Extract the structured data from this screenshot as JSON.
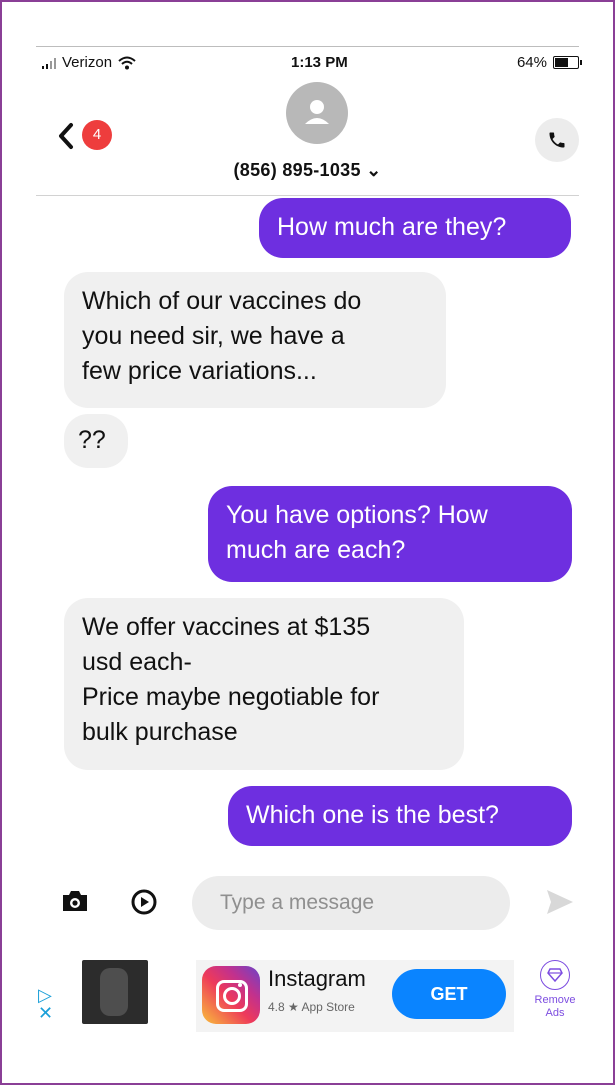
{
  "status_bar": {
    "carrier": "Verizon",
    "time": "1:13 PM",
    "battery": "64%",
    "battery_fraction": 0.64
  },
  "header": {
    "unread_count": "4",
    "contact": "(856) 895-1035 ⌄"
  },
  "messages": [
    {
      "direction": "outgoing",
      "lines": [
        "How much are they?"
      ]
    },
    {
      "direction": "incoming",
      "lines": [
        "Which of our vaccines do",
        "you need sir, we have a",
        "few price variations..."
      ]
    },
    {
      "direction": "incoming",
      "lines": [
        "??"
      ]
    },
    {
      "direction": "outgoing",
      "lines": [
        "You have options? How",
        "much are each?"
      ]
    },
    {
      "direction": "incoming",
      "lines": [
        "We offer vaccines at $135",
        "usd each-",
        "Price maybe negotiable for",
        "bulk purchase"
      ]
    },
    {
      "direction": "outgoing",
      "lines": [
        "Which one is the best?"
      ]
    }
  ],
  "composer": {
    "placeholder": "Type a message"
  },
  "ad": {
    "app_name": "Instagram",
    "rating": "4.8 ★ App Store",
    "cta": "GET",
    "remove_ads": [
      "Remove",
      "Ads"
    ]
  },
  "colors": {
    "outgoing_bubble": "#6e2fe0",
    "incoming_bubble": "#f0f0f0",
    "badge": "#ee3d3d",
    "get_button": "#0a84ff",
    "frame_border": "#8a3f96"
  }
}
